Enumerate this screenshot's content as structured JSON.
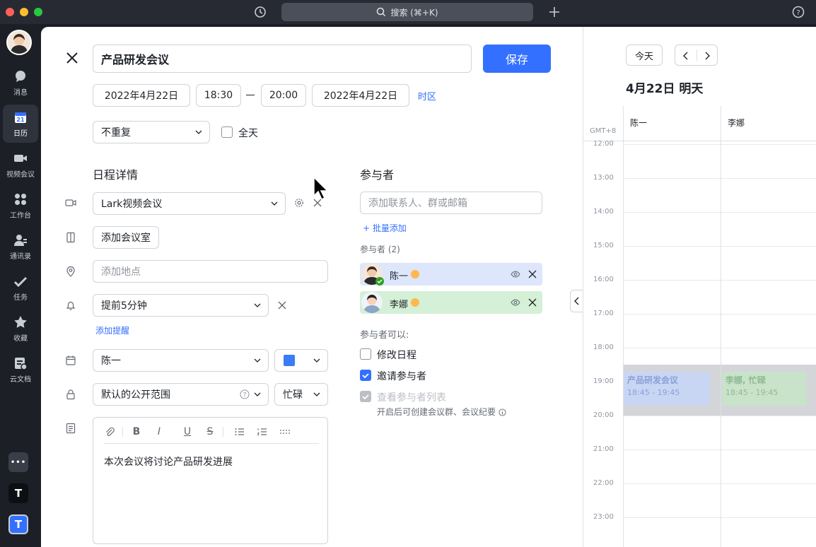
{
  "topbar": {
    "search_label": "搜索 (⌘+K)",
    "icons": [
      "history-icon",
      "search-icon",
      "plus-icon",
      "help-icon"
    ]
  },
  "sidebar": {
    "items": [
      {
        "label": "消息",
        "icon": "message-icon"
      },
      {
        "label": "日历",
        "icon": "calendar-icon",
        "active": true,
        "badge": "21"
      },
      {
        "label": "视频会议",
        "icon": "video-icon"
      },
      {
        "label": "工作台",
        "icon": "workplace-icon"
      },
      {
        "label": "通讯录",
        "icon": "contacts-icon"
      },
      {
        "label": "任务",
        "icon": "task-icon"
      },
      {
        "label": "收藏",
        "icon": "star-icon"
      },
      {
        "label": "云文档",
        "icon": "docs-icon"
      }
    ],
    "bottom": {
      "more": "•••",
      "app_t1": "T",
      "app_t2": "T"
    }
  },
  "editor": {
    "title": "产品研发会议",
    "save_label": "保存",
    "start_date": "2022年4月22日",
    "start_time": "18:30",
    "end_time": "20:00",
    "end_date": "2022年4月22日",
    "timezone_link": "时区",
    "repeat": "不重复",
    "all_day_label": "全天",
    "details_title": "日程详情",
    "video_meeting": "Lark视频会议",
    "add_room": "添加会议室",
    "location_placeholder": "添加地点",
    "reminder": "提前5分钟",
    "add_reminder": "添加提醒",
    "calendar_owner": "陈一",
    "calendar_color": "#3b7cf6",
    "visibility": "默认的公开范围",
    "busy_status": "忙碌",
    "description": "本次会议将讨论产品研发进展"
  },
  "attendees": {
    "title": "参与者",
    "input_placeholder": "添加联系人、群或邮箱",
    "bulk_add": "批量添加",
    "count_label": "参与者 (2)",
    "list": [
      {
        "name": "陈一",
        "bg": "#dde6fb"
      },
      {
        "name": "李娜",
        "bg": "#d4f0d6"
      }
    ],
    "permissions_title": "参与者可以:",
    "permissions": [
      {
        "label": "修改日程",
        "checked": false
      },
      {
        "label": "邀请参与者",
        "checked": true
      },
      {
        "label": "查看参与者列表",
        "checked": true,
        "disabled": true
      }
    ],
    "perm_note": "开启后可创建会议群、会议纪要"
  },
  "calendar_view": {
    "today_btn": "今天",
    "date_title": "4月22日 明天",
    "timezone": "GMT+8",
    "columns": [
      "陈一",
      "李娜"
    ],
    "hours": [
      "12:00",
      "13:00",
      "14:00",
      "15:00",
      "16:00",
      "17:00",
      "18:00",
      "19:00",
      "20:00",
      "21:00",
      "22:00",
      "23:00"
    ],
    "events": [
      {
        "title": "产品研发会议",
        "time": "18:45 - 19:45",
        "color": "#c9d6f3",
        "text": "#8a9fd8"
      },
      {
        "title": "李娜, 忙碌",
        "time": "18:45 - 19:45",
        "color": "#c8e3c9",
        "text": "#8fb993"
      }
    ]
  }
}
